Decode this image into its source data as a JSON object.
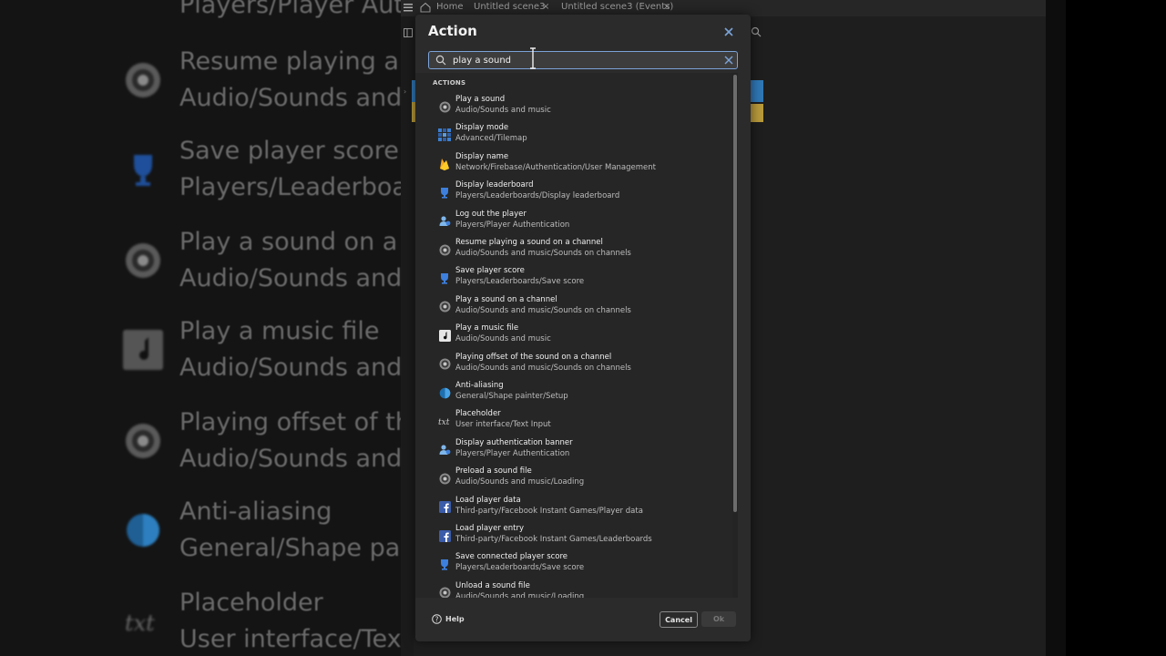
{
  "app": {
    "tabs": [
      {
        "label": "Home"
      },
      {
        "label": "Untitled scene3"
      },
      {
        "label": "Untitled scene3 (Events)"
      }
    ]
  },
  "background_list": [
    {
      "title": "Players/Player Auth",
      "subtitle": ""
    },
    {
      "title": "Resume playing a s",
      "subtitle": "Audio/Sounds and"
    },
    {
      "title": "Save player score",
      "subtitle": "Players/Leaderboar"
    },
    {
      "title": "Play a sound on a c",
      "subtitle": "Audio/Sounds and"
    },
    {
      "title": "Play a music file",
      "subtitle": "Audio/Sounds and"
    },
    {
      "title": "Playing offset of the",
      "subtitle": "Audio/Sounds and"
    },
    {
      "title": "Anti-aliasing",
      "subtitle": "General/Shape pai"
    },
    {
      "title": "Placeholder",
      "subtitle": "User interface/Text"
    }
  ],
  "dialog": {
    "title": "Action",
    "search": {
      "value": "play a sound",
      "placeholder": ""
    },
    "section_header": "ACTIONS",
    "items": [
      {
        "title": "Play a sound",
        "subtitle": "Audio/Sounds and music",
        "icon": "speaker-icon"
      },
      {
        "title": "Display mode",
        "subtitle": "Advanced/Tilemap",
        "icon": "tilemap-icon"
      },
      {
        "title": "Display name",
        "subtitle": "Network/Firebase/Authentication/User Management",
        "icon": "firebase-icon"
      },
      {
        "title": "Display leaderboard",
        "subtitle": "Players/Leaderboards/Display leaderboard",
        "icon": "trophy-icon"
      },
      {
        "title": "Log out the player",
        "subtitle": "Players/Player Authentication",
        "icon": "user-auth-icon"
      },
      {
        "title": "Resume playing a sound on a channel",
        "subtitle": "Audio/Sounds and music/Sounds on channels",
        "icon": "speaker-icon"
      },
      {
        "title": "Save player score",
        "subtitle": "Players/Leaderboards/Save score",
        "icon": "trophy-icon"
      },
      {
        "title": "Play a sound on a channel",
        "subtitle": "Audio/Sounds and music/Sounds on channels",
        "icon": "speaker-icon"
      },
      {
        "title": "Play a music file",
        "subtitle": "Audio/Sounds and music",
        "icon": "music-note-icon"
      },
      {
        "title": "Playing offset of the sound on a channel",
        "subtitle": "Audio/Sounds and music/Sounds on channels",
        "icon": "speaker-icon"
      },
      {
        "title": "Anti-aliasing",
        "subtitle": "General/Shape painter/Setup",
        "icon": "shape-painter-icon"
      },
      {
        "title": "Placeholder",
        "subtitle": "User interface/Text Input",
        "icon": "text-input-icon"
      },
      {
        "title": "Display authentication banner",
        "subtitle": "Players/Player Authentication",
        "icon": "user-auth-icon"
      },
      {
        "title": "Preload a sound file",
        "subtitle": "Audio/Sounds and music/Loading",
        "icon": "speaker-icon"
      },
      {
        "title": "Load player data",
        "subtitle": "Third-party/Facebook Instant Games/Player data",
        "icon": "facebook-icon"
      },
      {
        "title": "Load player entry",
        "subtitle": "Third-party/Facebook Instant Games/Leaderboards",
        "icon": "facebook-icon"
      },
      {
        "title": "Save connected player score",
        "subtitle": "Players/Leaderboards/Save score",
        "icon": "trophy-icon"
      },
      {
        "title": "Unload a sound file",
        "subtitle": "Audio/Sounds and music/Loading",
        "icon": "speaker-icon"
      }
    ],
    "help_label": "Help",
    "cancel_label": "Cancel",
    "ok_label": "Ok"
  }
}
